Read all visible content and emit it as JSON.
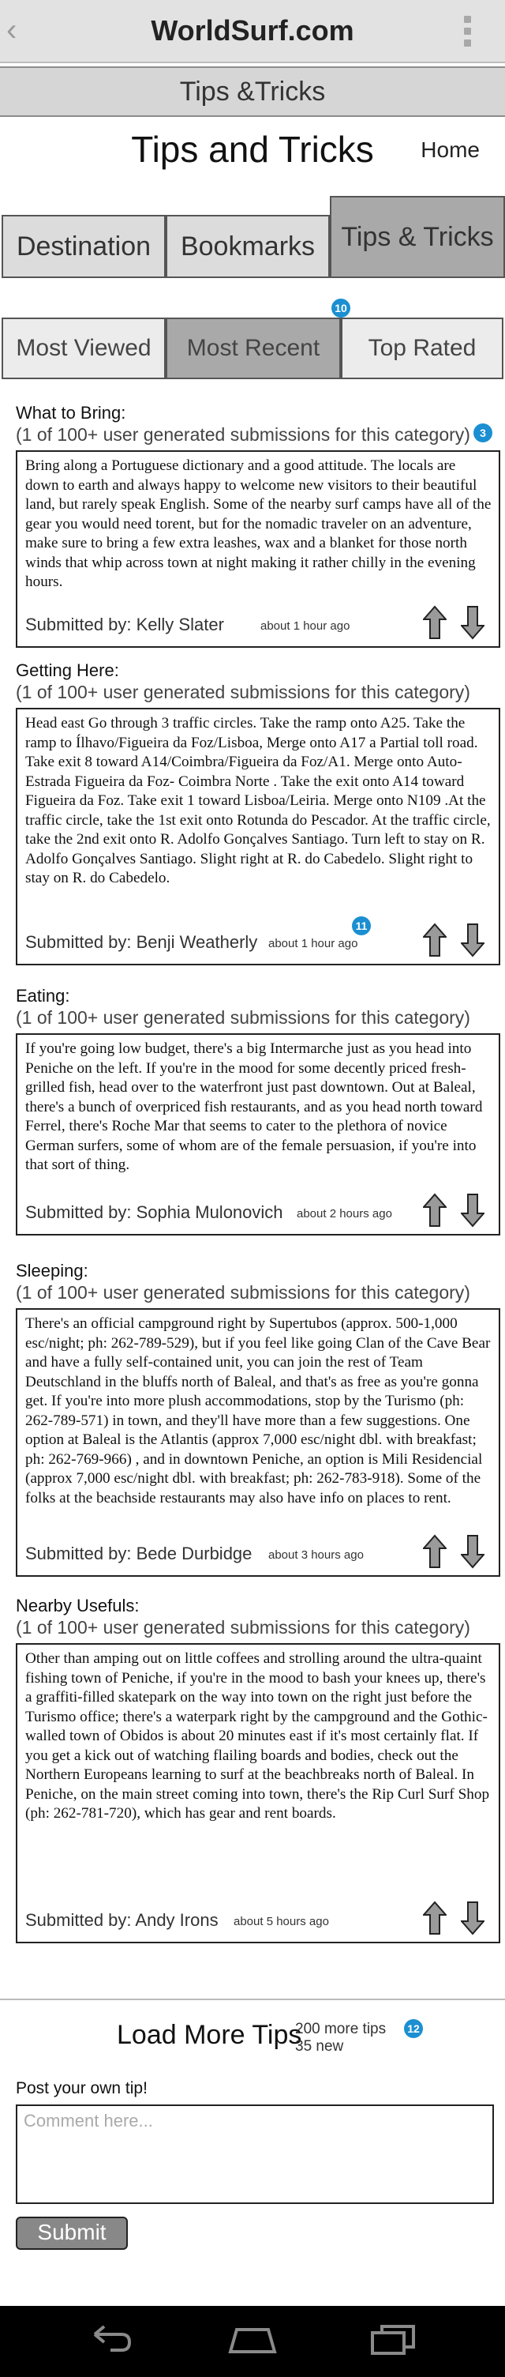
{
  "app": {
    "title": "WorldSurf.com"
  },
  "subheader": {
    "title": "Tips &Tricks"
  },
  "page": {
    "title": "Tips and Tricks",
    "home_label": "Home"
  },
  "nav_tabs": [
    {
      "label": "Destination"
    },
    {
      "label": "Bookmarks"
    },
    {
      "label": "Tips & Tricks",
      "selected": true
    }
  ],
  "sort_tabs": [
    {
      "label": "Most Viewed"
    },
    {
      "label": "Most Recent",
      "selected": true
    },
    {
      "label": "Top Rated"
    }
  ],
  "badges": {
    "sort": "10",
    "first_tip": "3",
    "getting_here": "11",
    "load_more": "12"
  },
  "sections": [
    {
      "title": "What to Bring:",
      "subtitle": "(1 of 100+ user generated submissions for this category)",
      "text": "Bring along a Portuguese dictionary and a good attitude. The locals are down to earth and always happy to welcome new visitors to their beautiful land, but rarely speak English. Some of the nearby surf camps have all of the gear you would need torent, but for the nomadic traveler on an adventure, make sure to bring a few extra leashes, wax and a blanket for those north winds that whip across town at night making it rather chilly in the evening hours.",
      "submitted_by": "Submitted by: Kelly Slater",
      "time": "about 1 hour ago"
    },
    {
      "title": "Getting Here:",
      "subtitle": "(1 of 100+ user generated submissions for this category)",
      "text": "Head east Go through 3 traffic circles. Take the ramp onto A25. Take the ramp to Ílhavo/Figueira da Foz/Lisboa, Merge onto A17 a Partial toll road. Take exit 8 toward A14/Coimbra/Figueira da Foz/A1. Merge onto Auto-Estrada Figueira da Foz- Coimbra Norte . Take the exit onto A14 toward Figueira da Foz. Take exit 1 toward Lisboa/Leiria. Merge onto N109 .At the traffic circle, take the 1st exit onto Rotunda do Pescador. At the traffic circle, take the 2nd exit onto R. Adolfo Gonçalves Santiago. Turn left to stay on R. Adolfo Gonçalves Santiago. Slight right at R. do Cabedelo. Slight right to stay on R. do Cabedelo.",
      "submitted_by": "Submitted by: Benji Weatherly",
      "time": "about 1 hour ago"
    },
    {
      "title": "Eating:",
      "subtitle": "(1 of 100+ user generated submissions for this category)",
      "text": "If you're going low budget, there's a big Intermarche just as you head into Peniche on the left. If you're in the mood for some decently priced fresh-grilled fish, head over to the waterfront just past downtown. Out at Baleal, there's a bunch of overpriced fish restaurants, and as you head north toward Ferrel, there's Roche Mar that seems to cater to the plethora of novice German surfers, some of whom are of the female persuasion, if you're into that sort of thing.",
      "submitted_by": "Submitted by: Sophia Mulonovich",
      "time": "about 2 hours ago"
    },
    {
      "title": "Sleeping:",
      "subtitle": "(1 of 100+ user generated submissions for this category)",
      "text": "There's an official campground right by Supertubos (approx. 500-1,000 esc/night; ph: 262-789-529), but if you feel like going Clan of the Cave Bear and have a fully self-contained unit, you can join the rest of Team Deutschland in the bluffs north of Baleal, and that's as free as you're gonna get. If you're into more plush accommodations, stop by the Turismo (ph: 262-789-571) in town, and they'll have more than a few suggestions. One option at Baleal is the Atlantis (approx 7,000 esc/night dbl. with breakfast; ph: 262-769-966) , and in downtown Peniche, an option is Mili Residencial (approx 7,000 esc/night dbl. with breakfast; ph: 262-783-918). Some of the folks at the beachside restaurants may also have info on places to rent.",
      "submitted_by": "Submitted by: Bede Durbidge",
      "time": "about 3 hours ago"
    },
    {
      "title": "Nearby Usefuls:",
      "subtitle": "(1 of 100+ user generated submissions for this category)",
      "text": "Other than amping out on little coffees and strolling around the ultra-quaint fishing town of Peniche, if you're in the mood to bash your knees up, there's a graffiti-filled skatepark on the way into town on the right just before the Turismo office; there's a waterpark right by the campground and the Gothic-walled town of Obidos is about 20 minutes east if it's most certainly flat. If you get a kick out of watching flailing boards and bodies, check out the Northern Europeans learning to surf at the beachbreaks north of Baleal. In Peniche, on the main street coming into town, there's the Rip Curl Surf Shop (ph: 262-781-720), which has gear and rent boards.",
      "submitted_by": "Submitted by: Andy Irons",
      "time": "about 5 hours ago"
    }
  ],
  "load_more": {
    "label": "Load More Tips",
    "count": "200 more tips",
    "new": "35 new"
  },
  "post": {
    "label": "Post your own tip!",
    "placeholder": "Comment here...",
    "submit_label": "Submit"
  },
  "icons": {
    "back": "back-chevron-icon",
    "menu": "overflow-menu-icon",
    "up": "arrow-up-icon",
    "down": "arrow-down-icon"
  },
  "colors": {
    "badge": "#1b8fd1",
    "selected_tab": "#a9a9a9",
    "tab": "#dcdcdc"
  }
}
